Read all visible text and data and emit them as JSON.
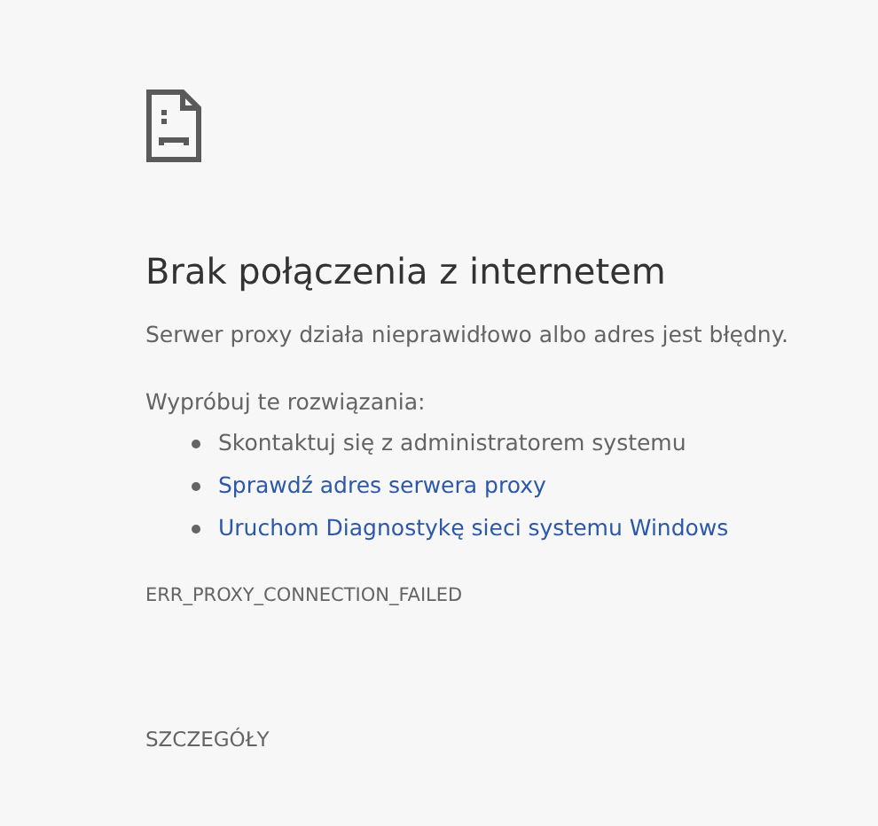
{
  "heading": "Brak połączenia z internetem",
  "message": "Serwer proxy działa nieprawidłowo albo adres jest błędny.",
  "suggestions_title": "Wypróbuj te rozwiązania:",
  "suggestions": [
    {
      "kind": "text",
      "label": "Skontaktuj się z administratorem systemu"
    },
    {
      "kind": "link",
      "label": "Sprawdź adres serwera proxy"
    },
    {
      "kind": "link",
      "label": "Uruchom Diagnostykę sieci systemu Windows"
    }
  ],
  "error_code": "ERR_PROXY_CONNECTION_FAILED",
  "details_button": "SZCZEGÓŁY"
}
